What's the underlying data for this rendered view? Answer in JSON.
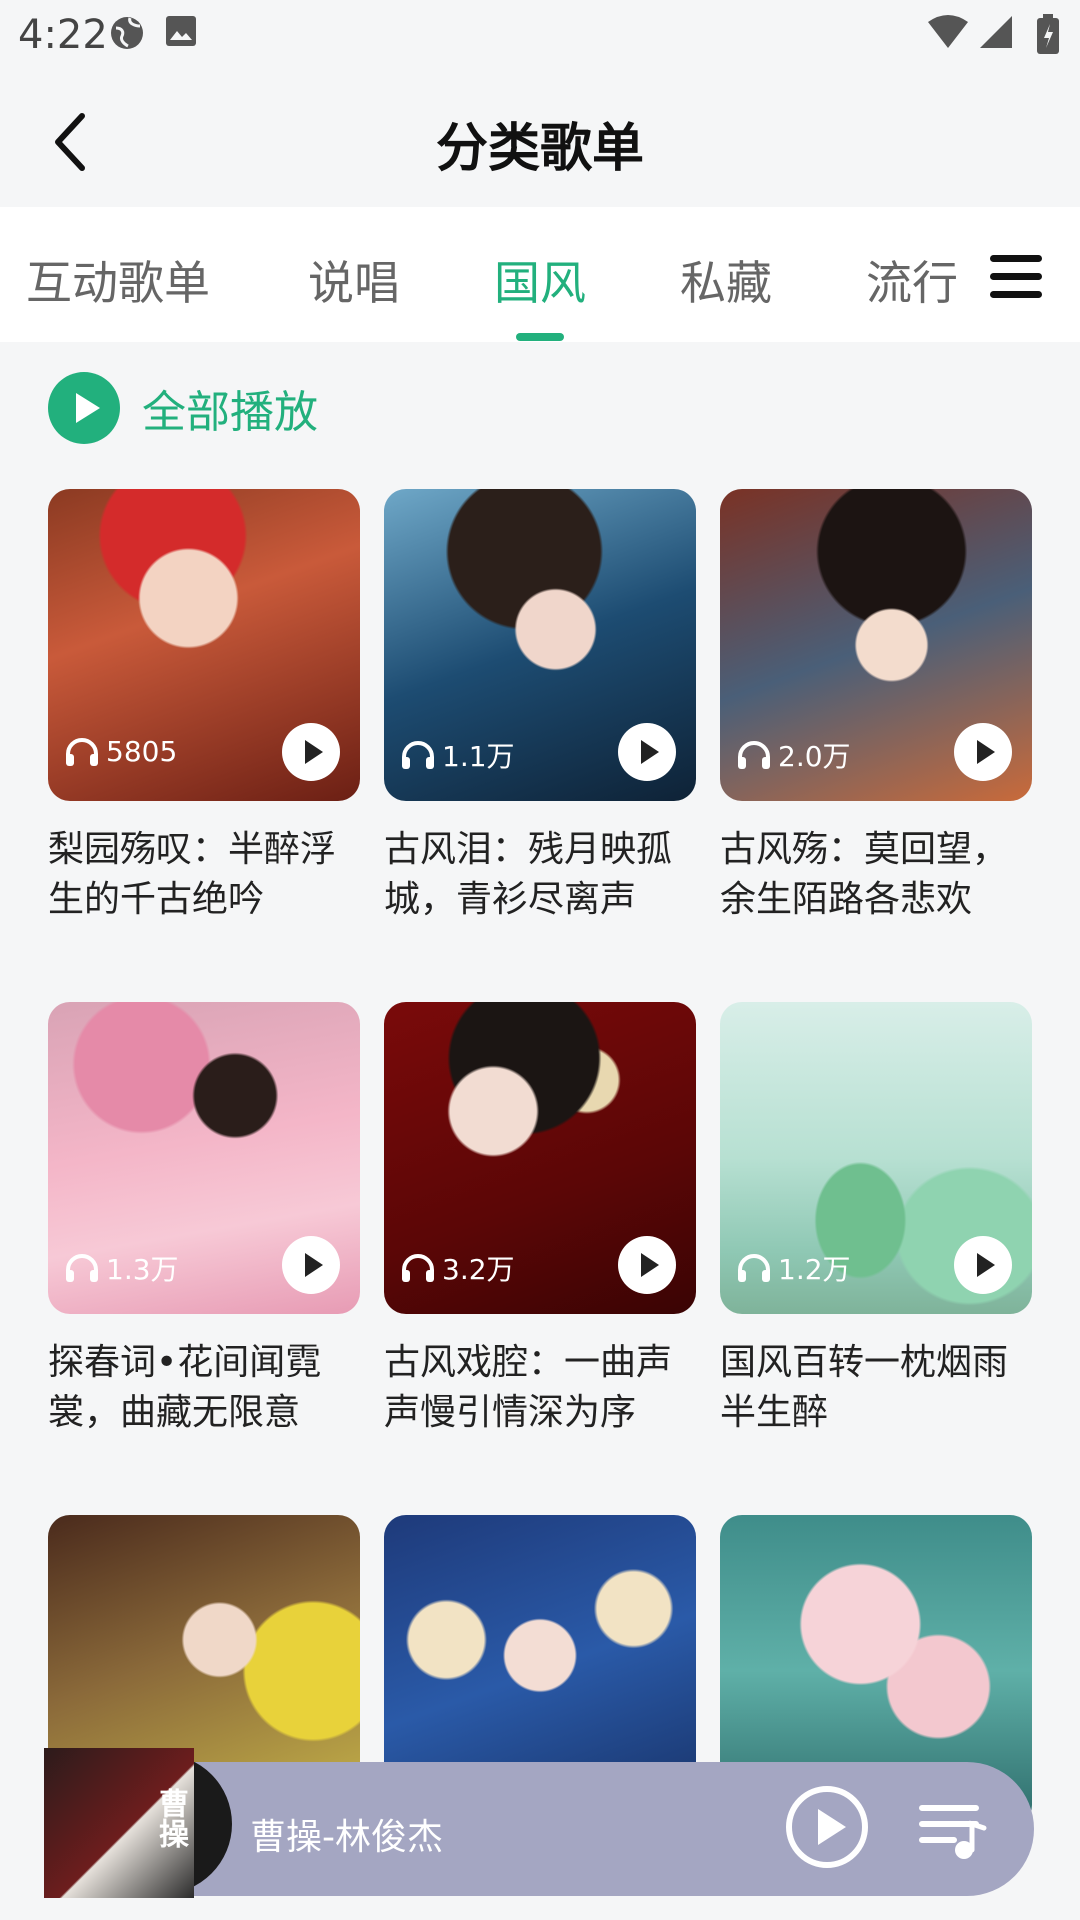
{
  "status": {
    "time": "4:22",
    "icons": [
      "globe-icon",
      "image-icon",
      "wifi-icon",
      "signal-icon",
      "battery-icon"
    ]
  },
  "header": {
    "title": "分类歌单",
    "back_icon": "chevron-left-icon"
  },
  "tabs": [
    {
      "label": "互动歌单",
      "active": false
    },
    {
      "label": "说唱",
      "active": false
    },
    {
      "label": "国风",
      "active": true
    },
    {
      "label": "私藏",
      "active": false
    },
    {
      "label": "流行",
      "active": false
    }
  ],
  "menu_icon": "hamburger-menu-icon",
  "play_all": {
    "label": "全部播放"
  },
  "playlists": [
    {
      "title": "梨园殇叹：半醉浮生的千古绝吟",
      "plays": "5805"
    },
    {
      "title": "古风泪：残月映孤城，青衫尽离声",
      "plays": "1.1万"
    },
    {
      "title": "古风殇：莫回望，余生陌路各悲欢",
      "plays": "2.0万"
    },
    {
      "title": "探春词•花间闻霓裳，曲藏无限意",
      "plays": "1.3万"
    },
    {
      "title": "古风戏腔：一曲声声慢引情深为序",
      "plays": "3.2万"
    },
    {
      "title": "国风百转一枕烟雨半生醉",
      "plays": "1.2万"
    },
    {
      "title": "",
      "plays": ""
    },
    {
      "title": "",
      "plays": ""
    },
    {
      "title": "",
      "plays": ""
    }
  ],
  "player": {
    "song": "曹操-林俊杰",
    "album_text": "曹操",
    "play_icon": "play-circle-icon",
    "playlist_icon": "playlist-icon"
  },
  "colors": {
    "accent": "#22b07d",
    "player_bg": "#a4a6c2",
    "background": "#f5f6f7"
  }
}
